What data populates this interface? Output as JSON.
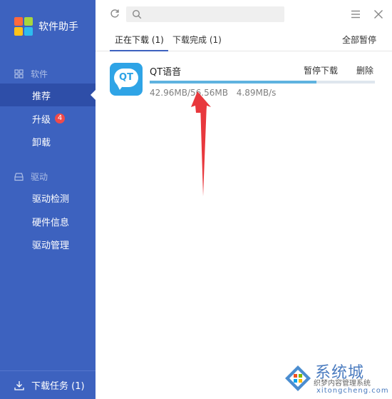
{
  "app": {
    "title": "软件助手"
  },
  "sidebar": {
    "software_section": {
      "label": "软件",
      "icon": "grid-icon"
    },
    "items_software": [
      {
        "label": "推荐",
        "active": true
      },
      {
        "label": "升级",
        "badge": "4"
      },
      {
        "label": "卸载"
      }
    ],
    "driver_section": {
      "label": "驱动",
      "icon": "disk-icon"
    },
    "items_driver": [
      {
        "label": "驱动检测"
      },
      {
        "label": "硬件信息"
      },
      {
        "label": "驱动管理"
      }
    ],
    "bottom": {
      "label": "下载任务 (1)",
      "icon": "download-icon"
    }
  },
  "toolbar": {
    "search_placeholder": "",
    "refresh_icon": "refresh-icon",
    "menu_icon": "hamburger-icon",
    "close_icon": "close-icon"
  },
  "tabs": {
    "downloading": "正在下载 (1)",
    "completed": "下载完成 (1)",
    "pause_all": "全部暂停"
  },
  "download": {
    "name": "QT语音",
    "icon_text": "QT",
    "pause": "暂停下载",
    "delete": "删除",
    "downloaded": "42.96MB/56.56MB",
    "speed": "4.89MB/s",
    "progress": 0.74
  },
  "watermark": {
    "title": "系统城",
    "sub": "织梦内容管理系统",
    "url": "xitongcheng.com"
  },
  "colors": {
    "sidebar": "#3d62bf",
    "sidebar_active": "#2e4ea8",
    "progress": "#5fb3e0",
    "badge": "#f04a4a",
    "arrow": "#e8383d"
  }
}
